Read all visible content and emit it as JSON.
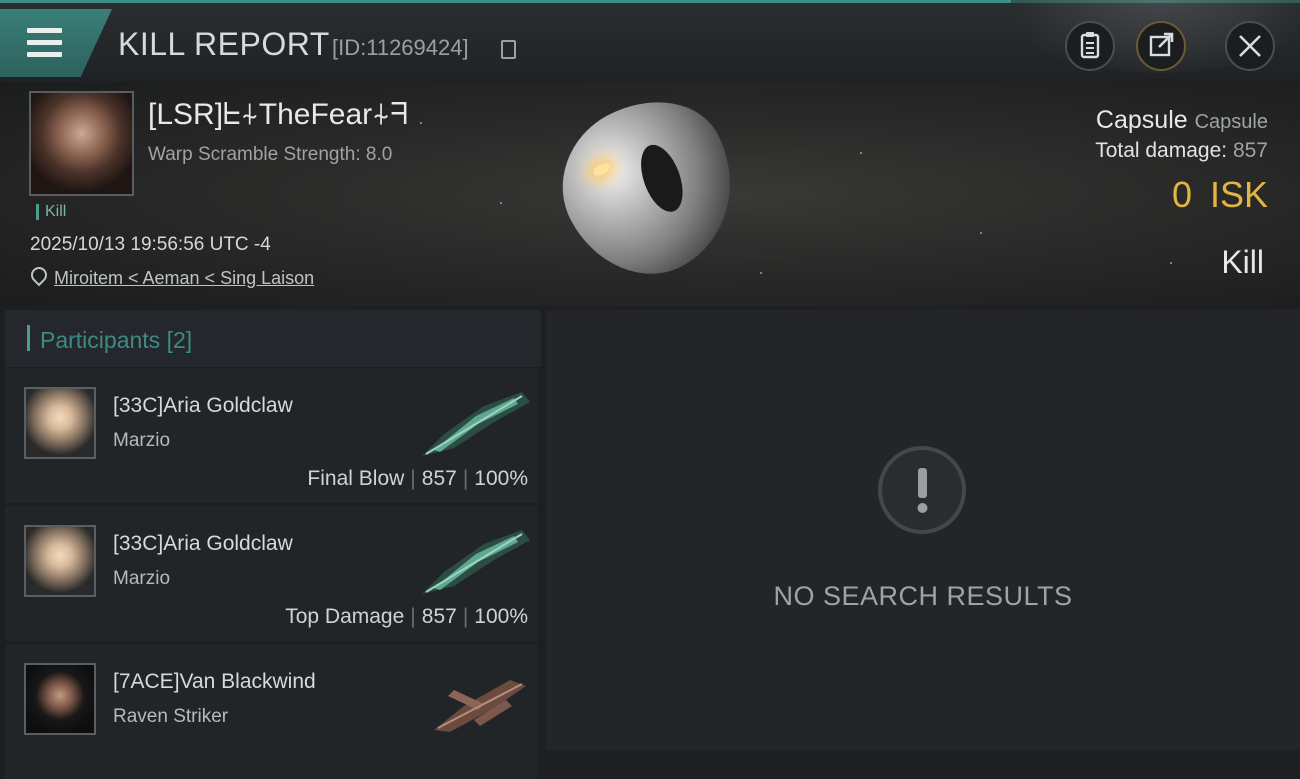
{
  "header": {
    "title": "KILL REPORT",
    "report_id": "[ID:11269424]"
  },
  "victim": {
    "name": "[LSR]ᖶ⍭TheFear⍭ᖷ",
    "warp_scramble": "Warp Scramble Strength: 8.0",
    "tag": "Kill",
    "timestamp": "2025/10/13 19:56:56 UTC -4",
    "location": "Miroitem < Aeman < Sing Laison",
    "ship_name": "Capsule",
    "ship_class": "Capsule",
    "total_damage_label": "Total damage:",
    "total_damage": "857",
    "isk_value": "0",
    "isk_unit": "ISK",
    "result": "Kill"
  },
  "participants": {
    "title": "Participants",
    "count": "[2]",
    "items": [
      {
        "name": "[33C]Aria Goldclaw",
        "ship": "Marzio",
        "role": "Final Blow",
        "damage": "857",
        "percent": "100%"
      },
      {
        "name": "[33C]Aria Goldclaw",
        "ship": "Marzio",
        "role": "Top Damage",
        "damage": "857",
        "percent": "100%"
      },
      {
        "name": "[7ACE]Van Blackwind",
        "ship": "Raven Striker"
      }
    ]
  },
  "results": {
    "empty_text": "NO SEARCH RESULTS"
  },
  "icons": [
    "menu-icon",
    "copy-icon",
    "clipboard-icon",
    "share-icon",
    "close-icon",
    "location-pin-icon",
    "alert-icon"
  ],
  "colors": {
    "accent": "#4b9c93",
    "isk": "#e0b542"
  }
}
